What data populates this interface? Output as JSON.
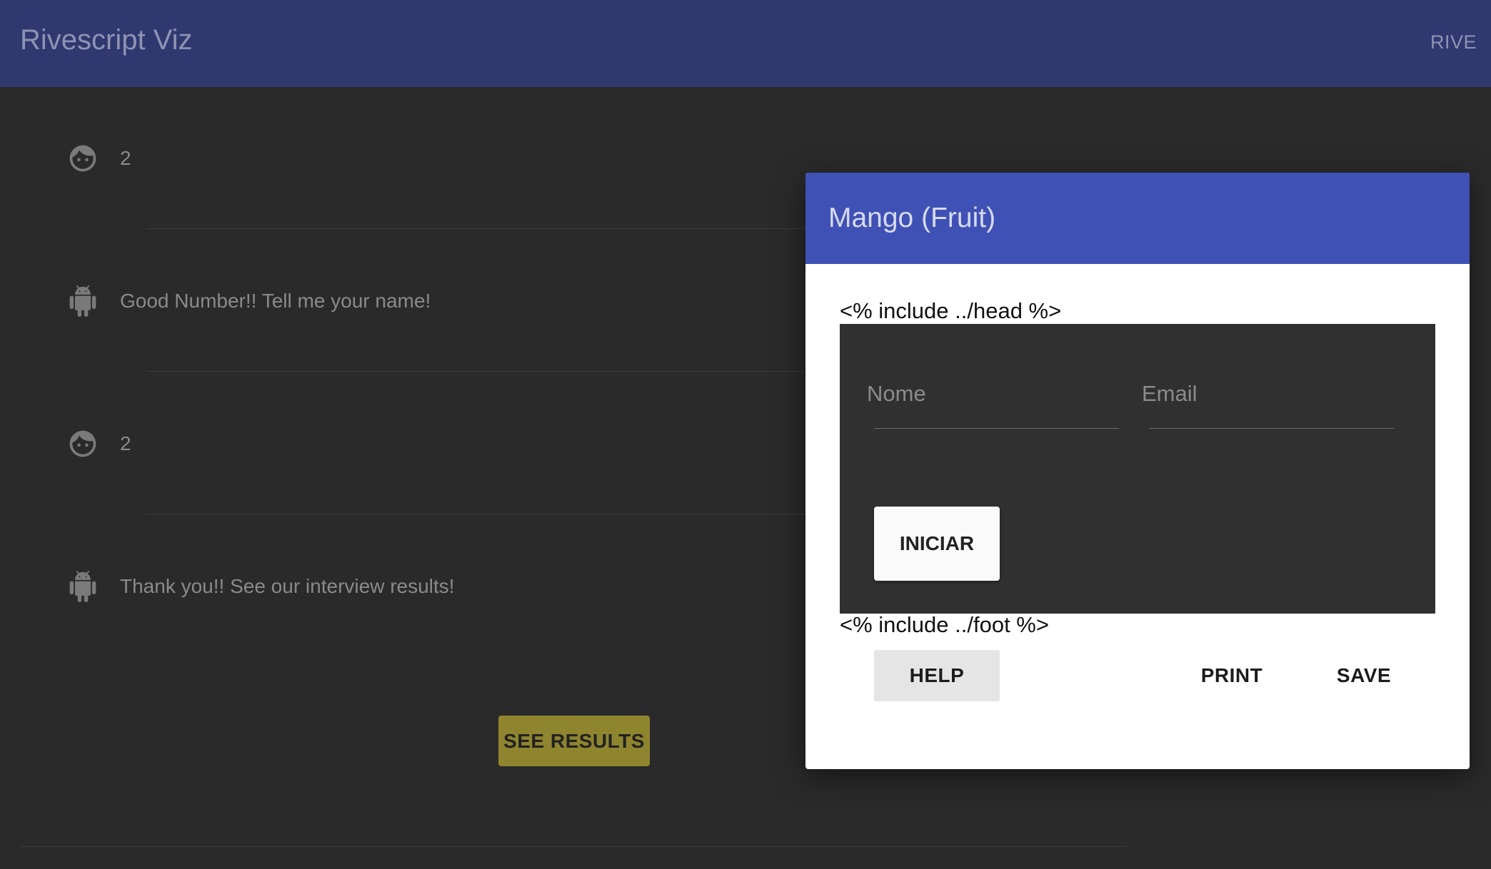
{
  "app": {
    "title": "Rivescript Viz",
    "nav_link": "RIVE"
  },
  "chat": {
    "messages": [
      {
        "sender": "user",
        "icon": "face-icon",
        "text": "2"
      },
      {
        "sender": "bot",
        "icon": "android-icon",
        "text": "Good Number!! Tell me your name!"
      },
      {
        "sender": "user",
        "icon": "face-icon",
        "text": "2"
      },
      {
        "sender": "bot",
        "icon": "android-icon",
        "text": "Thank you!! See our interview results!"
      }
    ],
    "see_results_label": "SEE RESULTS"
  },
  "dialog": {
    "title": "Mango (Fruit)",
    "head_include": "<% include ../head %>",
    "foot_include": "<% include ../foot %>",
    "form": {
      "name_placeholder": "Nome",
      "email_placeholder": "Email",
      "start_label": "INICIAR"
    },
    "actions": {
      "help": "HELP",
      "print": "PRINT",
      "save": "SAVE"
    }
  },
  "colors": {
    "appbar": "#303870",
    "dialog_header": "#3f51b5",
    "see_results": "#8f852e",
    "background": "#2a2a2a"
  }
}
